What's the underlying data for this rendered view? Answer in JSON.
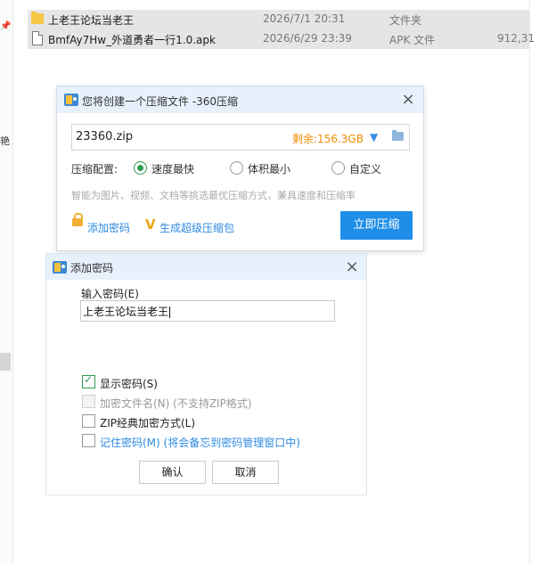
{
  "explorer": {
    "side_char": "艳",
    "files": [
      {
        "name": "上老王论坛当老王",
        "date": "2026/7/1 20:31",
        "type": "文件夹",
        "size": "",
        "icon": "folder-icon"
      },
      {
        "name": "BmfAy7Hw_外道勇者一行1.0.apk",
        "date": "2026/6/29 23:39",
        "type": "APK 文件",
        "size": "912,31",
        "icon": "file-icon"
      }
    ]
  },
  "compress_dialog": {
    "title": "您将创建一个压缩文件 -360压缩",
    "filename": "23360.zip",
    "remaining": "剩余:156.3GB",
    "config_label": "压缩配置:",
    "options": [
      {
        "label": "速度最快",
        "selected": true
      },
      {
        "label": "体积最小",
        "selected": false
      },
      {
        "label": "自定义",
        "selected": false
      }
    ],
    "hint": "智能为图片、视频、文档等挑选最优压缩方式，兼具速度和压缩率",
    "add_password_link": "添加密码",
    "super_compress_link": "生成超级压缩包",
    "compress_button": "立即压缩"
  },
  "password_dialog": {
    "title": "添加密码",
    "password_label": "输入密码(E)",
    "password_value": "上老王论坛当老王",
    "checkboxes": [
      {
        "label": "显示密码(S)",
        "checked": true,
        "disabled": false
      },
      {
        "label": "加密文件名(N) (不支持ZIP格式)",
        "checked": false,
        "disabled": true
      },
      {
        "label": "ZIP经典加密方式(L)",
        "checked": false,
        "disabled": false
      },
      {
        "label": "记住密码(M) (将会备忘到密码管理窗口中)",
        "checked": false,
        "disabled": false
      }
    ],
    "ok_button": "确认",
    "cancel_button": "取消"
  },
  "colors": {
    "accent": "#1e8ee8",
    "radio_check": "#2e9a51",
    "remaining_orange": "#f08c00",
    "link_blue": "#2d8ae0",
    "titlebar": "#e7f1fb"
  }
}
